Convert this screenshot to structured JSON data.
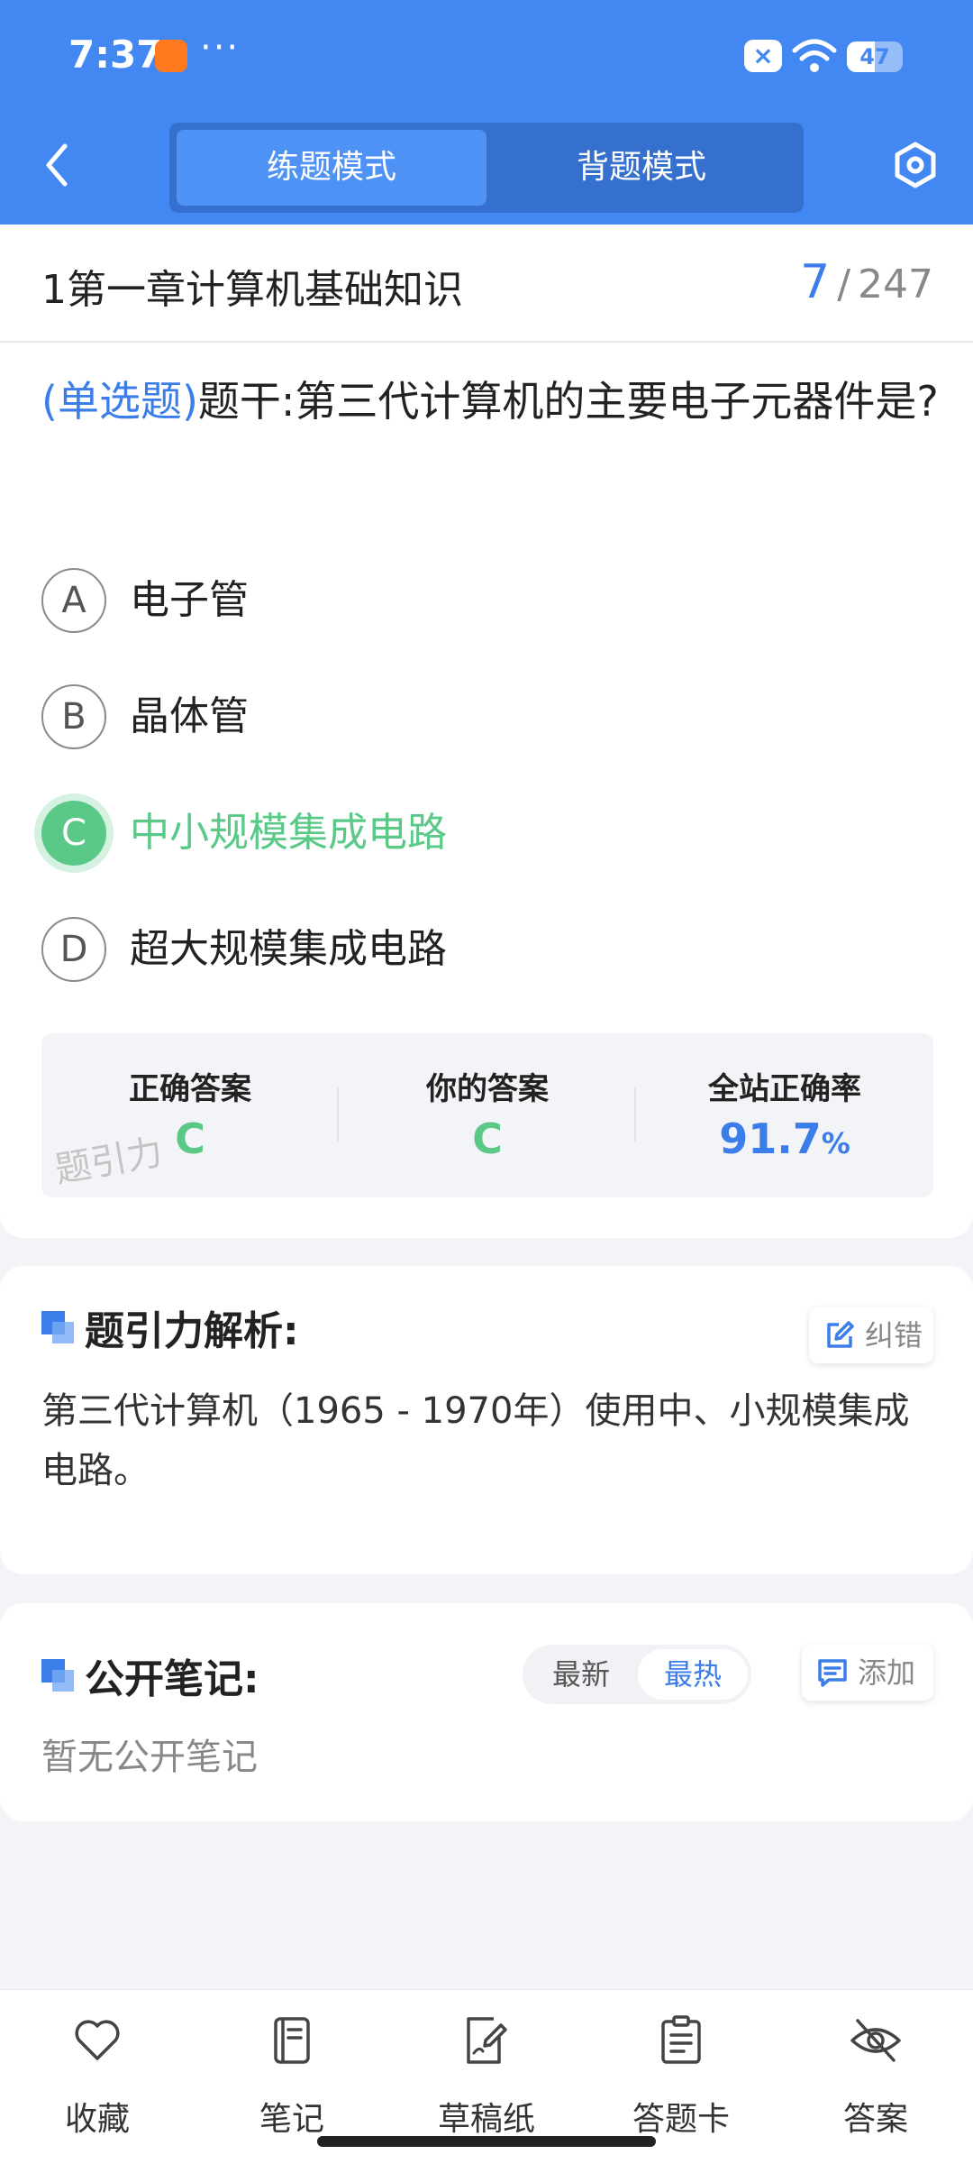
{
  "status_bar": {
    "time": "7:37",
    "more": "···",
    "close_badge": "×",
    "battery": "47"
  },
  "header": {
    "mode_tabs": [
      {
        "label": "练题模式",
        "active": true
      },
      {
        "label": "背题模式",
        "active": false
      }
    ],
    "accent_color": "#4388f2"
  },
  "chapter": {
    "title": "1第一章计算机基础知识",
    "current": "7",
    "separator": "/",
    "total": "247"
  },
  "question": {
    "type": "(单选题)",
    "stem": "题干:第三代计算机的主要电子元器件是?",
    "options": [
      {
        "letter": "A",
        "text": "电子管",
        "state": "normal"
      },
      {
        "letter": "B",
        "text": "晶体管",
        "state": "normal"
      },
      {
        "letter": "C",
        "text": "中小规模集成电路",
        "state": "correct"
      },
      {
        "letter": "D",
        "text": "超大规模集成电路",
        "state": "normal"
      }
    ]
  },
  "answer_summary": {
    "correct_label": "正确答案",
    "correct_value": "C",
    "yours_label": "你的答案",
    "yours_value": "C",
    "rate_label": "全站正确率",
    "rate_value": "91.7",
    "rate_unit": "%",
    "watermark": "题引力"
  },
  "analysis": {
    "title": "题引力解析:",
    "report_label": "纠错",
    "text": "第三代计算机（1965 - 1970年）使用中、小规模集成电路。"
  },
  "notes": {
    "title": "公开笔记:",
    "sort_newest": "最新",
    "sort_hot": "最热",
    "add_label": "添加",
    "empty_text": "暂无公开笔记"
  },
  "bottom_nav": [
    {
      "icon": "heart-icon",
      "label": "收藏"
    },
    {
      "icon": "notebook-icon",
      "label": "笔记"
    },
    {
      "icon": "draft-paper-icon",
      "label": "草稿纸"
    },
    {
      "icon": "answer-sheet-icon",
      "label": "答题卡"
    },
    {
      "icon": "eye-off-icon",
      "label": "答案"
    }
  ],
  "colors": {
    "primary": "#3b7de9",
    "correct": "#5ac987",
    "background": "#f3f4f7"
  }
}
